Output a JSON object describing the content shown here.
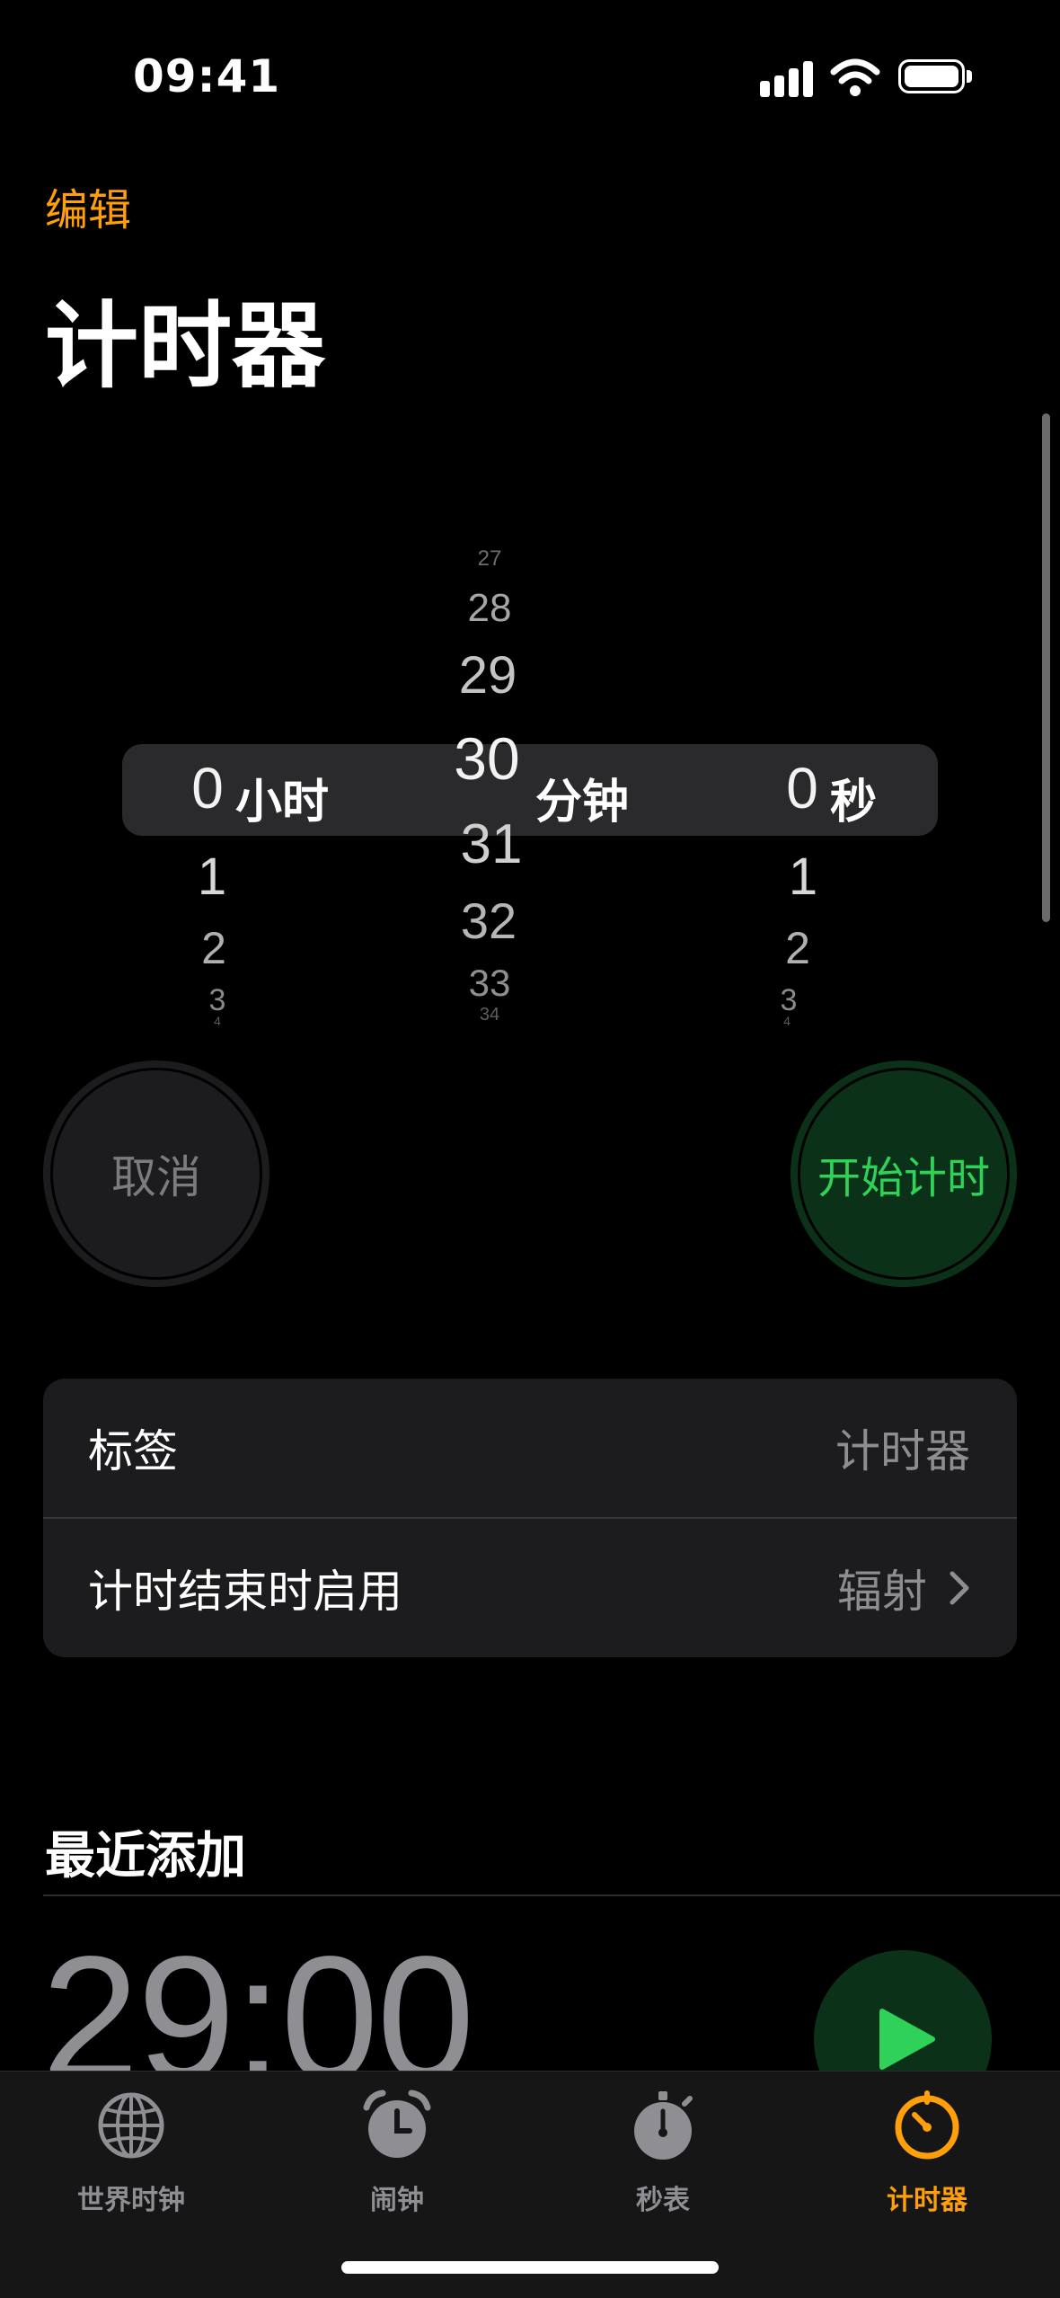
{
  "status_bar": {
    "time": "09:41"
  },
  "nav": {
    "edit_label": "编辑",
    "title": "计时器"
  },
  "picker": {
    "hours": {
      "selected": "0",
      "unit": "小时",
      "below": [
        "1",
        "2",
        "3",
        "4"
      ]
    },
    "minutes": {
      "above": [
        "27",
        "28",
        "29"
      ],
      "selected": "30",
      "unit": "分钟",
      "below": [
        "31",
        "32",
        "33",
        "34"
      ]
    },
    "seconds": {
      "selected": "0",
      "unit": "秒",
      "below": [
        "1",
        "2",
        "3",
        "4"
      ]
    }
  },
  "buttons": {
    "cancel_label": "取消",
    "start_label": "开始计时"
  },
  "settings": {
    "label_row": {
      "label": "标签",
      "value": "计时器"
    },
    "sound_row": {
      "label": "计时结束时启用",
      "value": "辐射"
    }
  },
  "recents": {
    "section_title": "最近添加",
    "items": [
      {
        "time": "29:00"
      }
    ]
  },
  "tabbar": {
    "tabs": [
      {
        "label": "世界时钟",
        "icon": "globe-icon"
      },
      {
        "label": "闹钟",
        "icon": "alarm-clock-icon"
      },
      {
        "label": "秒表",
        "icon": "stopwatch-icon"
      },
      {
        "label": "计时器",
        "icon": "timer-icon",
        "active": true
      }
    ]
  },
  "colors": {
    "accent": "#FF9F0A",
    "start_green": "#30D158",
    "background": "#000000"
  }
}
